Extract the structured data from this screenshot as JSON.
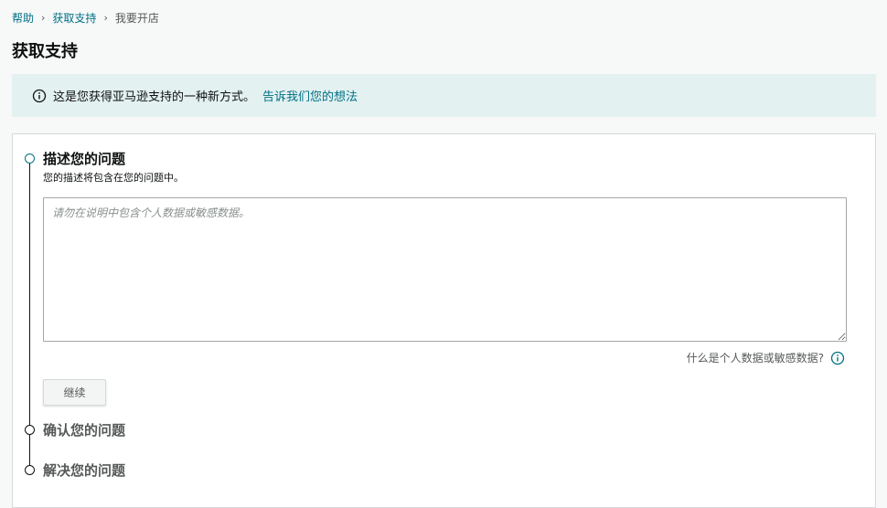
{
  "breadcrumb": {
    "items": [
      "帮助",
      "获取支持"
    ],
    "current": "我要开店"
  },
  "page": {
    "title": "获取支持"
  },
  "banner": {
    "icon": "info-icon",
    "message": "这是您获得亚马逊支持的一种新方式。",
    "link": "告诉我们您的想法"
  },
  "steps": [
    {
      "title": "描述您的问题",
      "subtitle": "您的描述将包含在您的问题中。",
      "active": true
    },
    {
      "title": "确认您的问题",
      "active": false
    },
    {
      "title": "解决您的问题",
      "active": false
    }
  ],
  "description": {
    "value": "",
    "placeholder": "请勿在说明中包含个人数据或敏感数据。"
  },
  "sensitive_help": {
    "label": "什么是个人数据或敏感数据?",
    "icon": "info-icon"
  },
  "continue_label": "继续",
  "colors": {
    "link": "#007185",
    "banner_bg": "#e3f1f1",
    "text": "#0f1111",
    "muted": "#565959"
  }
}
